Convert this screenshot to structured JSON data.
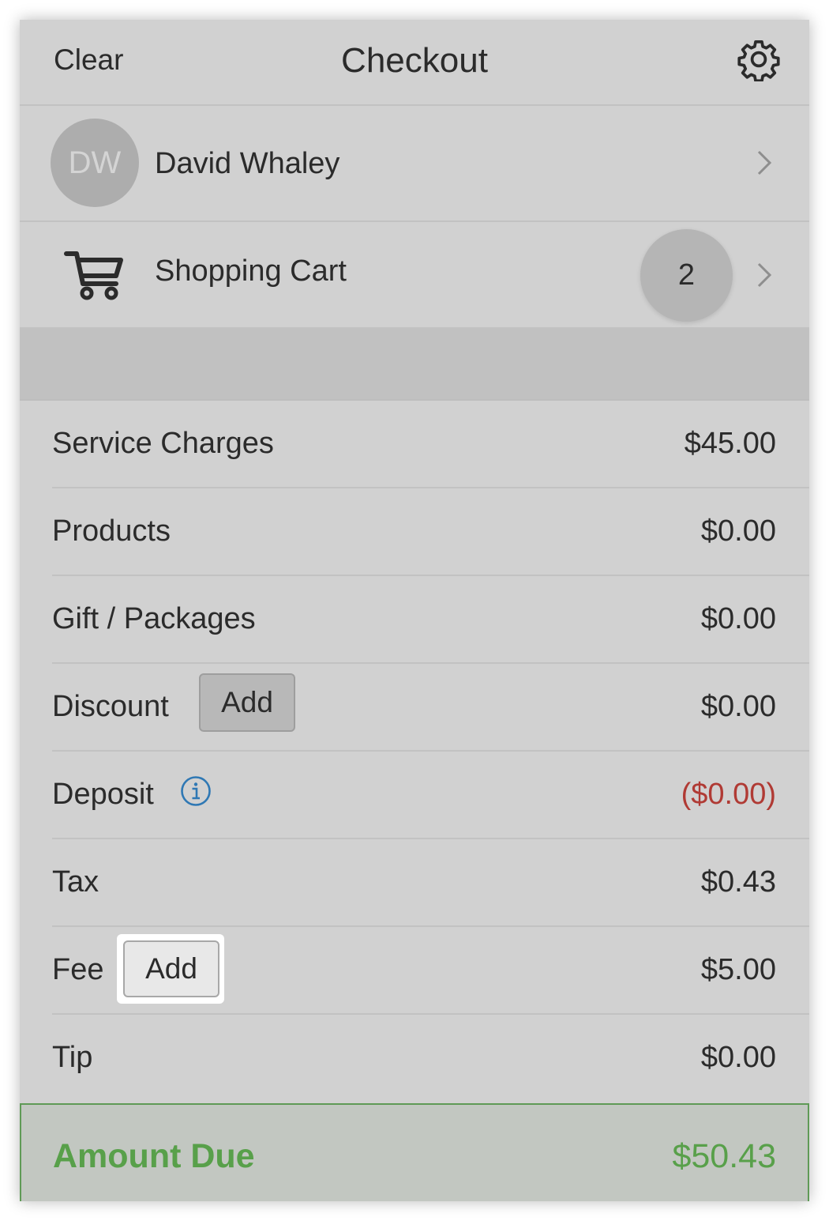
{
  "header": {
    "clear_label": "Clear",
    "title": "Checkout",
    "settings_icon": "gear-icon"
  },
  "customer": {
    "initials": "DW",
    "name": "David Whaley"
  },
  "cart": {
    "label": "Shopping Cart",
    "count": "2",
    "icon": "shopping-cart-icon"
  },
  "summary": {
    "service_charges": {
      "label": "Service Charges",
      "amount": "$45.00"
    },
    "products": {
      "label": "Products",
      "amount": "$0.00"
    },
    "gift_packages": {
      "label": "Gift / Packages",
      "amount": "$0.00"
    },
    "discount": {
      "label": "Discount",
      "add_label": "Add",
      "amount": "$0.00"
    },
    "deposit": {
      "label": "Deposit",
      "amount": "($0.00)"
    },
    "tax": {
      "label": "Tax",
      "amount": "$0.43"
    },
    "fee": {
      "label": "Fee",
      "add_label": "Add",
      "amount": "$5.00"
    },
    "tip": {
      "label": "Tip",
      "amount": "$0.00"
    }
  },
  "amount_due": {
    "label": "Amount Due",
    "amount": "$50.43"
  },
  "colors": {
    "panel_bg": "#d1d1d1",
    "accent_green": "#58a04a",
    "negative_red": "#b03a34",
    "info_blue": "#2f78b4"
  }
}
